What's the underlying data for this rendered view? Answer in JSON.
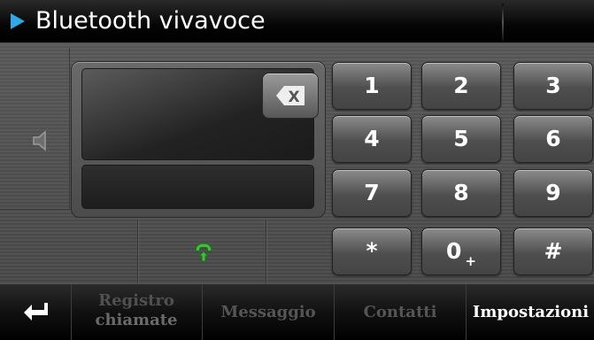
{
  "header": {
    "title": "Bluetooth vivavoce"
  },
  "keypad": [
    "1",
    "2",
    "3",
    "4",
    "5",
    "6",
    "7",
    "8",
    "9",
    "*",
    "0",
    "#"
  ],
  "keypad_zero_sub": "+",
  "backspace": {
    "label": "X"
  },
  "footer": {
    "tabs": [
      {
        "line1": "Registro",
        "line2": "chiamate",
        "enabled": false
      },
      {
        "line1": "Messaggio",
        "line2": "",
        "enabled": false
      },
      {
        "line1": "Contatti",
        "line2": "",
        "enabled": false
      },
      {
        "line1": "Impostazioni",
        "line2": "",
        "enabled": true
      }
    ]
  },
  "colors": {
    "accent": "#2fa8e6",
    "call_green": "#3fbf3a",
    "disabled_text": "#5a5a5a",
    "enabled_text": "#ffffff"
  }
}
